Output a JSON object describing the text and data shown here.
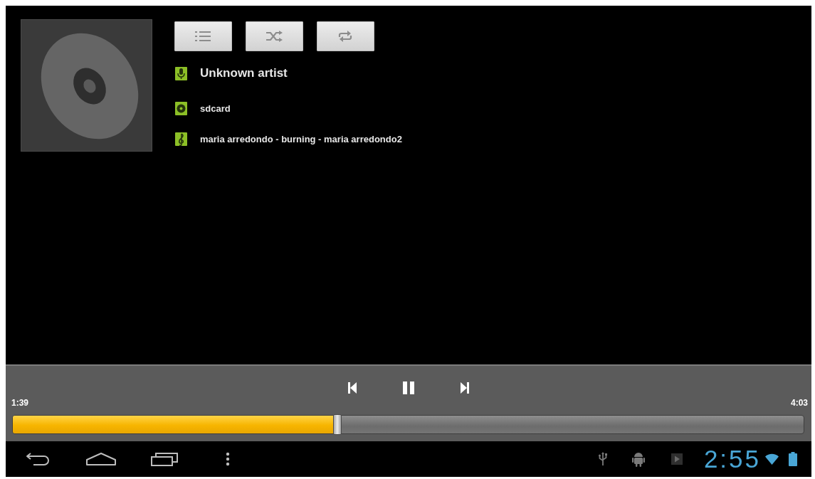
{
  "track_info": [
    {
      "kind": "artist",
      "text": "Unknown artist"
    },
    {
      "kind": "album",
      "text": "sdcard"
    },
    {
      "kind": "song",
      "text": "maria arredondo - burning - maria arredondo2"
    }
  ],
  "playback": {
    "playing": true,
    "elapsed": "1:39",
    "duration": "4:03",
    "progress": {
      "level": 0.41
    }
  },
  "system_bar": {
    "time": "2:55"
  }
}
